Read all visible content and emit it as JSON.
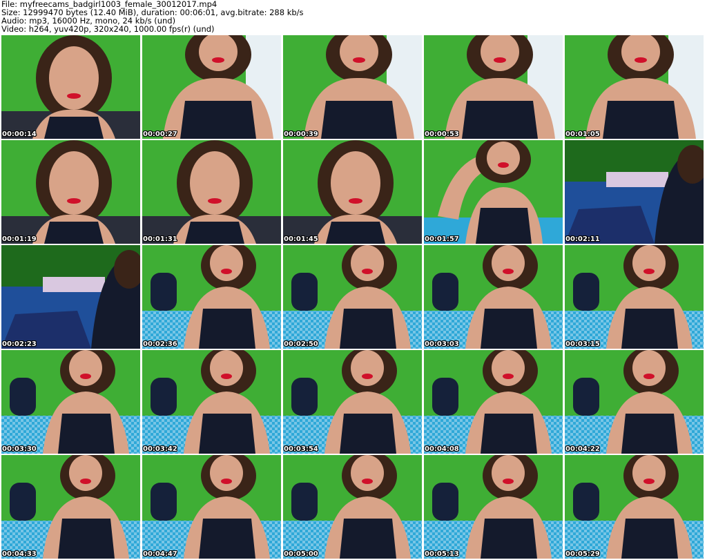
{
  "header": {
    "file_line": "File: myfreecams_badgirl1003_female_30012017.mp4",
    "size_line": "Size: 12999470 bytes (12.40 MiB), duration: 00:06:01, avg.bitrate: 288 kb/s",
    "audio_line": "Audio: mp3, 16000 Hz, mono, 24 kb/s (und)",
    "video_line": "Video: h264, yuv420p, 320x240, 1000.00 fps(r) (und)"
  },
  "thumbnails": [
    {
      "timestamp": "00:00:14",
      "scene": "face-close"
    },
    {
      "timestamp": "00:00:27",
      "scene": "torso-close"
    },
    {
      "timestamp": "00:00:39",
      "scene": "torso-close"
    },
    {
      "timestamp": "00:00:53",
      "scene": "torso-close"
    },
    {
      "timestamp": "00:01:05",
      "scene": "torso-close"
    },
    {
      "timestamp": "00:01:19",
      "scene": "face-close"
    },
    {
      "timestamp": "00:01:31",
      "scene": "face-close"
    },
    {
      "timestamp": "00:01:45",
      "scene": "face-close"
    },
    {
      "timestamp": "00:01:57",
      "scene": "arms-up"
    },
    {
      "timestamp": "00:02:11",
      "scene": "bed-dark"
    },
    {
      "timestamp": "00:02:23",
      "scene": "bed-dark"
    },
    {
      "timestamp": "00:02:36",
      "scene": "seated-bed"
    },
    {
      "timestamp": "00:02:50",
      "scene": "seated-bed"
    },
    {
      "timestamp": "00:03:03",
      "scene": "seated-bed"
    },
    {
      "timestamp": "00:03:15",
      "scene": "seated-bed"
    },
    {
      "timestamp": "00:03:30",
      "scene": "seated-bed"
    },
    {
      "timestamp": "00:03:42",
      "scene": "seated-bed"
    },
    {
      "timestamp": "00:03:54",
      "scene": "seated-bed"
    },
    {
      "timestamp": "00:04:08",
      "scene": "seated-bed"
    },
    {
      "timestamp": "00:04:22",
      "scene": "seated-bed"
    },
    {
      "timestamp": "00:04:33",
      "scene": "seated-bed"
    },
    {
      "timestamp": "00:04:47",
      "scene": "seated-bed"
    },
    {
      "timestamp": "00:05:00",
      "scene": "seated-bed"
    },
    {
      "timestamp": "00:05:13",
      "scene": "seated-bed"
    },
    {
      "timestamp": "00:05:29",
      "scene": "seated-bed"
    }
  ],
  "colors": {
    "wall_green": "#3fae35",
    "bed_blue": "#2fa8d8",
    "top_black": "#141a2c",
    "skin": "#d8a388",
    "hair": "#3a2418",
    "lips": "#d0102a"
  }
}
